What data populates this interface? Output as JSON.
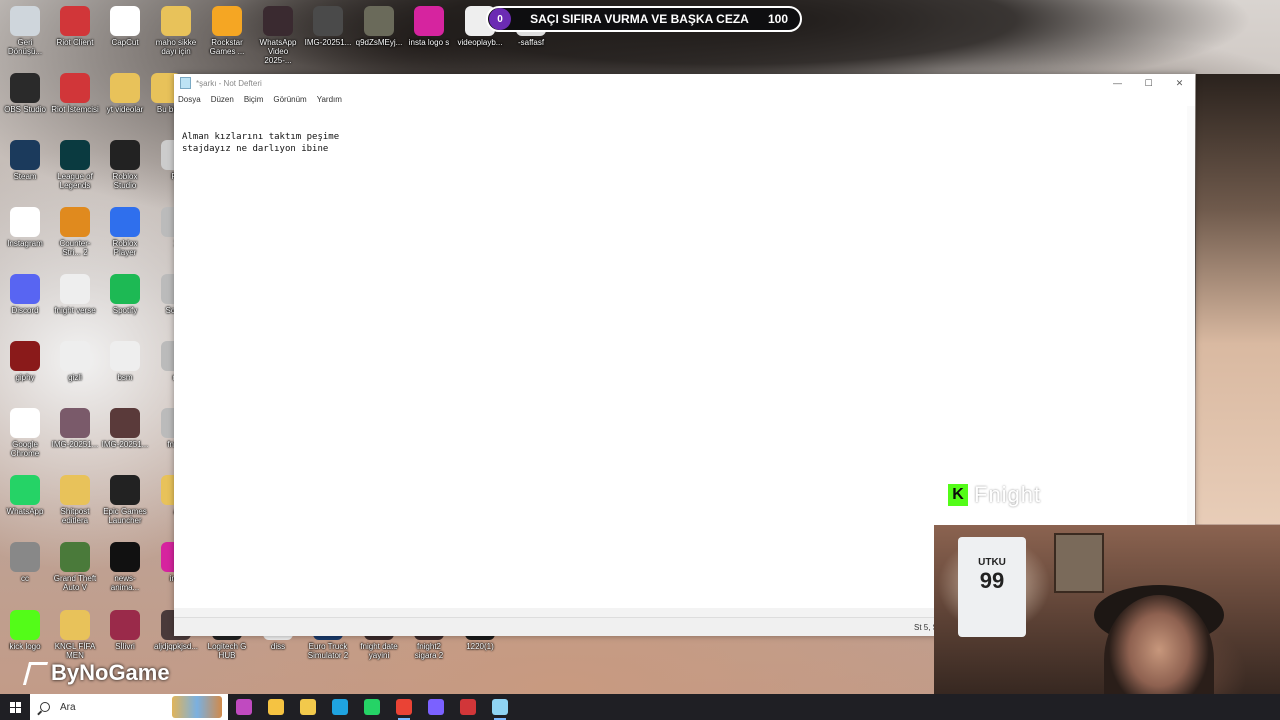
{
  "overlay": {
    "count": "0",
    "title": "SAÇI SIFIRA VURMA VE BAŞKA CEZA",
    "score": "100"
  },
  "desktop_icons": [
    {
      "label": "Geri Dönüşü...",
      "icon": "recycle-bin-icon",
      "color": "#cfd6dc"
    },
    {
      "label": "Riot Client",
      "icon": "riot-icon",
      "color": "#d13639"
    },
    {
      "label": "CapCut",
      "icon": "capcut-icon",
      "color": "#ffffff"
    },
    {
      "label": "maho sikke dayı için",
      "icon": "folder-icon",
      "color": "#e8c25a"
    },
    {
      "label": "Rockstar Games ...",
      "icon": "rockstar-icon",
      "color": "#f5a623"
    },
    {
      "label": "WhatsApp Video 2025-...",
      "icon": "video-icon",
      "color": "#3a2a30"
    },
    {
      "label": "IMG-20251...",
      "icon": "image-icon",
      "color": "#4a4a4a"
    },
    {
      "label": "q9dZsMEyj...",
      "icon": "image-icon",
      "color": "#6a6a5a"
    },
    {
      "label": "insta logo s",
      "icon": "instagram-icon",
      "color": "#d6249f"
    },
    {
      "label": "videoplayb...",
      "icon": "video-icon",
      "color": "#eeeeee"
    },
    {
      "label": "-saffasf",
      "icon": "file-icon",
      "color": "#dddddd"
    },
    {
      "label": "OBS Studio",
      "icon": "obs-icon",
      "color": "#2a2a2a"
    },
    {
      "label": "Riot İstemcisi",
      "icon": "riot-icon",
      "color": "#d13639"
    },
    {
      "label": "yt videolar",
      "icon": "folder-icon",
      "color": "#e8c25a"
    },
    {
      "label": "Bu bi",
      "icon": "folder-icon",
      "color": "#e8c25a"
    },
    {
      "label": "Steam",
      "icon": "steam-icon",
      "color": "#1b3a5c"
    },
    {
      "label": "League of Legends",
      "icon": "lol-icon",
      "color": "#0a3a40"
    },
    {
      "label": "Roblox Studio",
      "icon": "roblox-studio-icon",
      "color": "#222222"
    },
    {
      "label": "Fn",
      "icon": "file-icon",
      "color": "#cccccc"
    },
    {
      "label": "Instagram",
      "icon": "chrome-icon",
      "color": "#ffffff"
    },
    {
      "label": "Counter-Stri... 2",
      "icon": "cs-icon",
      "color": "#e08a1e"
    },
    {
      "label": "Roblox Player",
      "icon": "roblox-icon",
      "color": "#2f6fed"
    },
    {
      "label": "1",
      "icon": "file-icon",
      "color": "#bbbbbb"
    },
    {
      "label": "Discord",
      "icon": "discord-icon",
      "color": "#5865f2"
    },
    {
      "label": "fnight verse",
      "icon": "file-icon",
      "color": "#eeeeee"
    },
    {
      "label": "Spotify",
      "icon": "spotify-icon",
      "color": "#1db954"
    },
    {
      "label": "Scree",
      "icon": "file-icon",
      "color": "#bbbbbb"
    },
    {
      "label": "giphy",
      "icon": "image-icon",
      "color": "#8a1a1a"
    },
    {
      "label": "gizli",
      "icon": "file-icon",
      "color": "#eeeeee"
    },
    {
      "label": "bsm",
      "icon": "file-icon",
      "color": "#eeeeee"
    },
    {
      "label": "rp",
      "icon": "file-icon",
      "color": "#bbbbbb"
    },
    {
      "label": "Google Chrome",
      "icon": "chrome-icon",
      "color": "#ffffff"
    },
    {
      "label": "IMG-20251...",
      "icon": "image-icon",
      "color": "#7a5a6a"
    },
    {
      "label": "IMG-20251...",
      "icon": "image-icon",
      "color": "#5a3a3a"
    },
    {
      "label": "fnigh",
      "icon": "file-icon",
      "color": "#bbbbbb"
    },
    {
      "label": "WhatsApp",
      "icon": "whatsapp-icon",
      "color": "#25d366"
    },
    {
      "label": "Shitpost editlera",
      "icon": "folder-icon",
      "color": "#e8c25a"
    },
    {
      "label": "Epic Games Launcher",
      "icon": "epic-icon",
      "color": "#222222"
    },
    {
      "label": "a",
      "icon": "folder-icon",
      "color": "#e8c25a"
    },
    {
      "label": "cc",
      "icon": "file-icon",
      "color": "#888888"
    },
    {
      "label": "Grand Theft Auto V",
      "icon": "gta-icon",
      "color": "#4a7a3a"
    },
    {
      "label": "news-anima...",
      "icon": "video-icon",
      "color": "#111111"
    },
    {
      "label": "inst",
      "icon": "file-icon",
      "color": "#d6249f"
    },
    {
      "label": "kick logo",
      "icon": "kick-icon",
      "color": "#53fc18"
    },
    {
      "label": "KNGL FİFA MEN",
      "icon": "folder-icon",
      "color": "#e8c25a"
    },
    {
      "label": "Sİlivri",
      "icon": "s-icon",
      "color": "#9a2a4a"
    },
    {
      "label": "aljdjqpkjsd...",
      "icon": "file-icon",
      "color": "#4a3a3a"
    },
    {
      "label": "Logitech G HUB",
      "icon": "logitech-icon",
      "color": "#222222"
    },
    {
      "label": "diss",
      "icon": "file-icon",
      "color": "#eeeeee"
    },
    {
      "label": "Euro Truck Simulator 2",
      "icon": "ets-icon",
      "color": "#1a3a6a"
    },
    {
      "label": "fnight date yayini",
      "icon": "folder-icon",
      "color": "#3a2a2a"
    },
    {
      "label": "fnight2 sigara 2",
      "icon": "folder-icon",
      "color": "#3a2a2a"
    },
    {
      "label": "1220(1)",
      "icon": "image-icon",
      "color": "#1a1a1a"
    }
  ],
  "notepad": {
    "title": "*şarkı - Not Defteri",
    "menu": [
      "Dosya",
      "Düzen",
      "Biçim",
      "Görünüm",
      "Yardım"
    ],
    "text_lines": [
      "Alman kızlarını taktım peşime",
      "stajdayız ne darlıyon ibine"
    ],
    "status_position": "St 5, S"
  },
  "watermark": {
    "text": "Fnight"
  },
  "webcam": {
    "shirt_name": "UTKU",
    "shirt_number": "99"
  },
  "brand": {
    "text": "ByNoGame"
  },
  "taskbar": {
    "search_placeholder": "Ara",
    "apps": [
      {
        "name": "colors-app-icon",
        "color": "#c04ac0"
      },
      {
        "name": "store-icon",
        "color": "#f5c342"
      },
      {
        "name": "file-explorer-icon",
        "color": "#f2c94c"
      },
      {
        "name": "edge-icon",
        "color": "#1fa3e0"
      },
      {
        "name": "whatsapp-taskbar-icon",
        "color": "#25d366"
      },
      {
        "name": "chrome-taskbar-icon",
        "color": "#ea4335"
      },
      {
        "name": "messenger-icon",
        "color": "#7b61ff"
      },
      {
        "name": "riot-taskbar-icon",
        "color": "#d13639"
      },
      {
        "name": "notepad-taskbar-icon",
        "color": "#8fd3f2"
      }
    ]
  }
}
